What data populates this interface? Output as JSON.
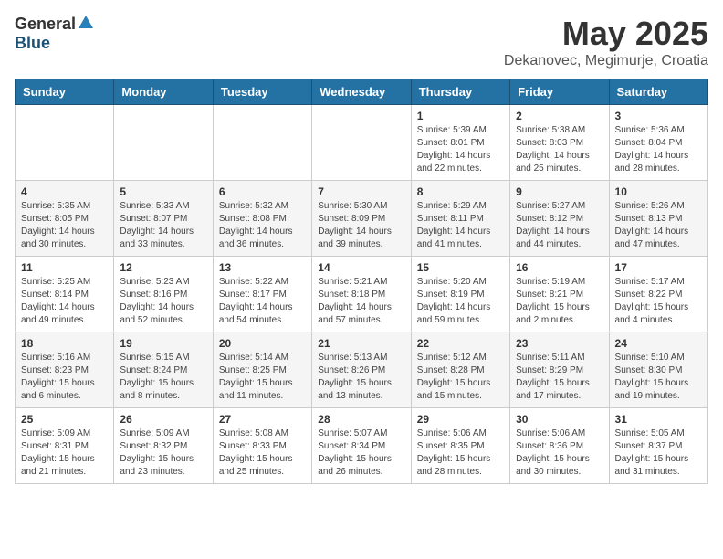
{
  "header": {
    "logo_general": "General",
    "logo_blue": "Blue",
    "title": "May 2025",
    "subtitle": "Dekanovec, Megimurje, Croatia"
  },
  "weekdays": [
    "Sunday",
    "Monday",
    "Tuesday",
    "Wednesday",
    "Thursday",
    "Friday",
    "Saturday"
  ],
  "weeks": [
    [
      {
        "day": "",
        "info": ""
      },
      {
        "day": "",
        "info": ""
      },
      {
        "day": "",
        "info": ""
      },
      {
        "day": "",
        "info": ""
      },
      {
        "day": "1",
        "info": "Sunrise: 5:39 AM\nSunset: 8:01 PM\nDaylight: 14 hours\nand 22 minutes."
      },
      {
        "day": "2",
        "info": "Sunrise: 5:38 AM\nSunset: 8:03 PM\nDaylight: 14 hours\nand 25 minutes."
      },
      {
        "day": "3",
        "info": "Sunrise: 5:36 AM\nSunset: 8:04 PM\nDaylight: 14 hours\nand 28 minutes."
      }
    ],
    [
      {
        "day": "4",
        "info": "Sunrise: 5:35 AM\nSunset: 8:05 PM\nDaylight: 14 hours\nand 30 minutes."
      },
      {
        "day": "5",
        "info": "Sunrise: 5:33 AM\nSunset: 8:07 PM\nDaylight: 14 hours\nand 33 minutes."
      },
      {
        "day": "6",
        "info": "Sunrise: 5:32 AM\nSunset: 8:08 PM\nDaylight: 14 hours\nand 36 minutes."
      },
      {
        "day": "7",
        "info": "Sunrise: 5:30 AM\nSunset: 8:09 PM\nDaylight: 14 hours\nand 39 minutes."
      },
      {
        "day": "8",
        "info": "Sunrise: 5:29 AM\nSunset: 8:11 PM\nDaylight: 14 hours\nand 41 minutes."
      },
      {
        "day": "9",
        "info": "Sunrise: 5:27 AM\nSunset: 8:12 PM\nDaylight: 14 hours\nand 44 minutes."
      },
      {
        "day": "10",
        "info": "Sunrise: 5:26 AM\nSunset: 8:13 PM\nDaylight: 14 hours\nand 47 minutes."
      }
    ],
    [
      {
        "day": "11",
        "info": "Sunrise: 5:25 AM\nSunset: 8:14 PM\nDaylight: 14 hours\nand 49 minutes."
      },
      {
        "day": "12",
        "info": "Sunrise: 5:23 AM\nSunset: 8:16 PM\nDaylight: 14 hours\nand 52 minutes."
      },
      {
        "day": "13",
        "info": "Sunrise: 5:22 AM\nSunset: 8:17 PM\nDaylight: 14 hours\nand 54 minutes."
      },
      {
        "day": "14",
        "info": "Sunrise: 5:21 AM\nSunset: 8:18 PM\nDaylight: 14 hours\nand 57 minutes."
      },
      {
        "day": "15",
        "info": "Sunrise: 5:20 AM\nSunset: 8:19 PM\nDaylight: 14 hours\nand 59 minutes."
      },
      {
        "day": "16",
        "info": "Sunrise: 5:19 AM\nSunset: 8:21 PM\nDaylight: 15 hours\nand 2 minutes."
      },
      {
        "day": "17",
        "info": "Sunrise: 5:17 AM\nSunset: 8:22 PM\nDaylight: 15 hours\nand 4 minutes."
      }
    ],
    [
      {
        "day": "18",
        "info": "Sunrise: 5:16 AM\nSunset: 8:23 PM\nDaylight: 15 hours\nand 6 minutes."
      },
      {
        "day": "19",
        "info": "Sunrise: 5:15 AM\nSunset: 8:24 PM\nDaylight: 15 hours\nand 8 minutes."
      },
      {
        "day": "20",
        "info": "Sunrise: 5:14 AM\nSunset: 8:25 PM\nDaylight: 15 hours\nand 11 minutes."
      },
      {
        "day": "21",
        "info": "Sunrise: 5:13 AM\nSunset: 8:26 PM\nDaylight: 15 hours\nand 13 minutes."
      },
      {
        "day": "22",
        "info": "Sunrise: 5:12 AM\nSunset: 8:28 PM\nDaylight: 15 hours\nand 15 minutes."
      },
      {
        "day": "23",
        "info": "Sunrise: 5:11 AM\nSunset: 8:29 PM\nDaylight: 15 hours\nand 17 minutes."
      },
      {
        "day": "24",
        "info": "Sunrise: 5:10 AM\nSunset: 8:30 PM\nDaylight: 15 hours\nand 19 minutes."
      }
    ],
    [
      {
        "day": "25",
        "info": "Sunrise: 5:09 AM\nSunset: 8:31 PM\nDaylight: 15 hours\nand 21 minutes."
      },
      {
        "day": "26",
        "info": "Sunrise: 5:09 AM\nSunset: 8:32 PM\nDaylight: 15 hours\nand 23 minutes."
      },
      {
        "day": "27",
        "info": "Sunrise: 5:08 AM\nSunset: 8:33 PM\nDaylight: 15 hours\nand 25 minutes."
      },
      {
        "day": "28",
        "info": "Sunrise: 5:07 AM\nSunset: 8:34 PM\nDaylight: 15 hours\nand 26 minutes."
      },
      {
        "day": "29",
        "info": "Sunrise: 5:06 AM\nSunset: 8:35 PM\nDaylight: 15 hours\nand 28 minutes."
      },
      {
        "day": "30",
        "info": "Sunrise: 5:06 AM\nSunset: 8:36 PM\nDaylight: 15 hours\nand 30 minutes."
      },
      {
        "day": "31",
        "info": "Sunrise: 5:05 AM\nSunset: 8:37 PM\nDaylight: 15 hours\nand 31 minutes."
      }
    ]
  ]
}
